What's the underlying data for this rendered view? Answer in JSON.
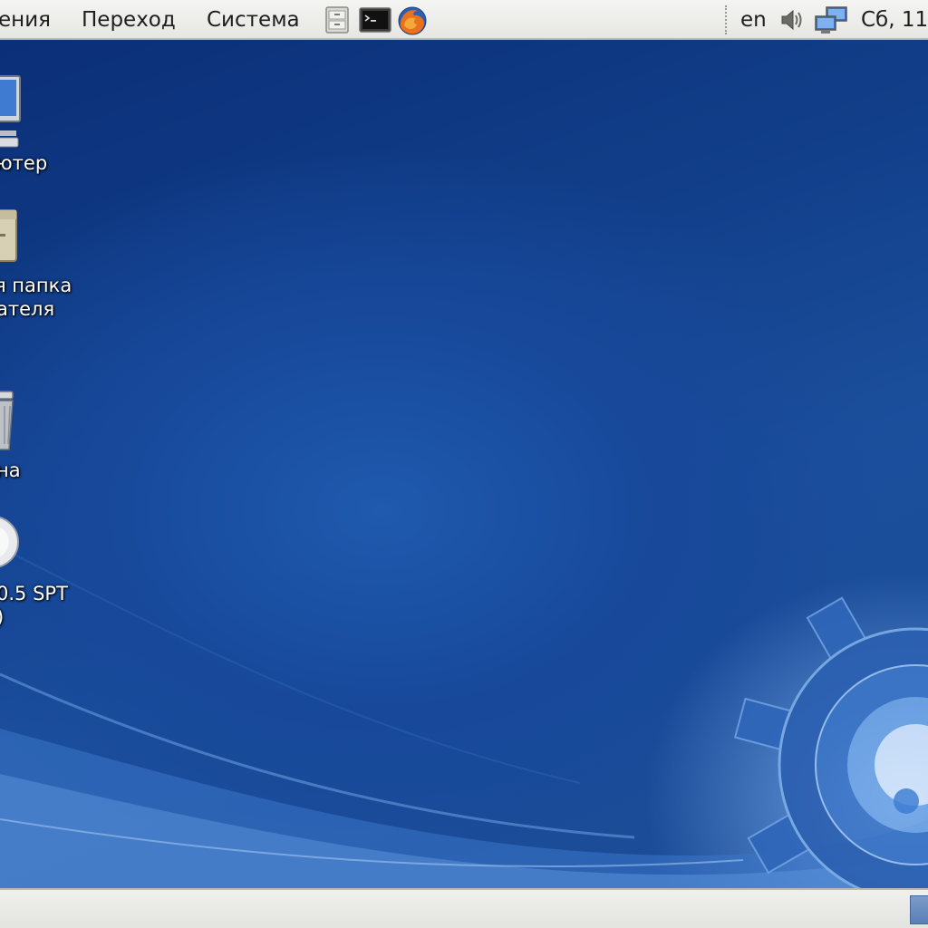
{
  "top_panel": {
    "menus": [
      {
        "label": "ения"
      },
      {
        "label": "Переход"
      },
      {
        "label": "Система"
      }
    ],
    "launchers": [
      {
        "icon": "file-cabinet-icon"
      },
      {
        "icon": "terminal-icon"
      },
      {
        "icon": "firefox-icon"
      }
    ],
    "tray": {
      "keyboard_layout": "en",
      "volume_icon": "speaker-icon",
      "network_icon": "network-icon",
      "clock": "Сб, 11"
    }
  },
  "desktop": {
    "icons": [
      {
        "label_lines": [
          "ютер"
        ],
        "icon": "computer-icon"
      },
      {
        "label_lines": [
          "я папка",
          "ателя"
        ],
        "icon": "home-folder-icon"
      },
      {
        "label_lines": [
          "на"
        ],
        "icon": "trash-icon"
      },
      {
        "label_lines": [
          "0.5 SPT",
          ")"
        ],
        "icon": "dvd-disc-icon"
      }
    ]
  },
  "colors": {
    "panel": "#ececea",
    "desktop_blue": "#123e86",
    "accent": "#5a7fb6"
  }
}
